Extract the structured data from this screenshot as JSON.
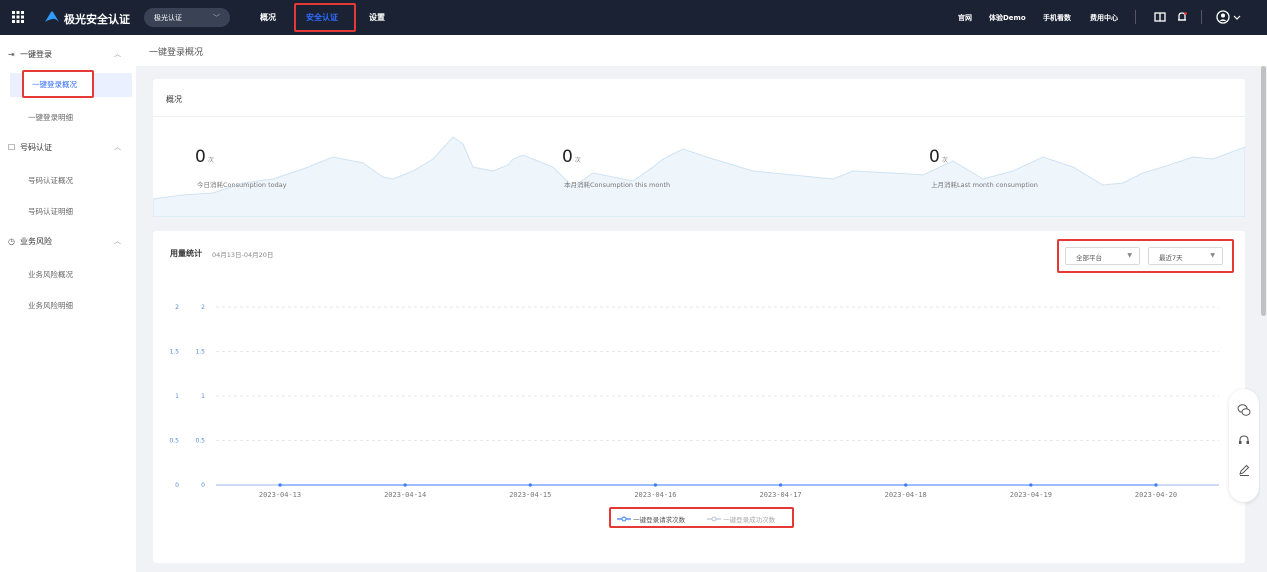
{
  "topbar": {
    "brand": "极光安全认证",
    "product_select": "极光认证",
    "nav": [
      "概况",
      "安全认证",
      "设置"
    ],
    "active_nav": "安全认证",
    "links": [
      "官网",
      "体验Demo",
      "手机看数",
      "费用中心"
    ]
  },
  "sidebar": {
    "groups": [
      {
        "label": "一键登录",
        "items": [
          "一键登录概况",
          "一键登录明细"
        ]
      },
      {
        "label": "号码认证",
        "items": [
          "号码认证概况",
          "号码认证明细"
        ]
      },
      {
        "label": "业务风险",
        "items": [
          "业务风险概况",
          "业务风险明细"
        ]
      }
    ],
    "active_item": "一键登录概况"
  },
  "breadcrumb": "一键登录概况",
  "overview": {
    "title": "概况",
    "stats": [
      {
        "value": "0",
        "unit": "次",
        "label": "今日消耗Consumption today"
      },
      {
        "value": "0",
        "unit": "次",
        "label": "本月消耗Consumption this month"
      },
      {
        "value": "0",
        "unit": "次",
        "label": "上月消耗Last month consumption"
      }
    ]
  },
  "usage": {
    "title": "用量统计",
    "range": "04月13日-04月20日",
    "platform_select": "全部平台",
    "period_select": "最近7天"
  },
  "chart_data": {
    "type": "line",
    "x": [
      "2023-04-13",
      "2023-04-14",
      "2023-04-15",
      "2023-04-16",
      "2023-04-17",
      "2023-04-18",
      "2023-04-19",
      "2023-04-20"
    ],
    "series": [
      {
        "name": "一键登录请求次数",
        "values": [
          0,
          0,
          0,
          0,
          0,
          0,
          0,
          0
        ],
        "color": "#3a7bff"
      },
      {
        "name": "一键登录成功次数",
        "values": [
          0,
          0,
          0,
          0,
          0,
          0,
          0,
          0
        ],
        "color": "#b8c4d6"
      }
    ],
    "y_ticks": [
      "0",
      "0.5",
      "1",
      "1.5",
      "2"
    ],
    "ylim": [
      0,
      2
    ],
    "grid": true,
    "legend": "bottom"
  }
}
